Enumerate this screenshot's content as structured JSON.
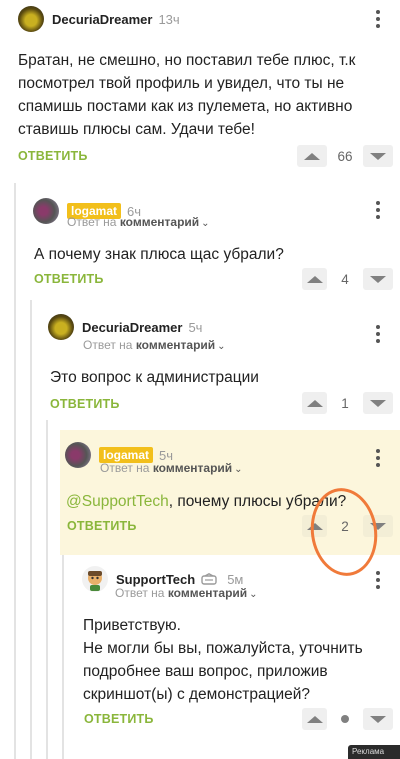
{
  "colors": {
    "accent": "#8ab63b",
    "tag": "#f2bf1b",
    "highlight": "#fcf6dc",
    "annotation": "#f07a3a"
  },
  "reply_prefix": "Ответ на",
  "reply_target": "комментарий",
  "reply_label": "ОТВЕТИТЬ",
  "comments": [
    {
      "author": "DecuriaDreamer",
      "time": "13ч",
      "text": "Братан, не смешно, но поставил тебе плюс, т.к посмотрел твой профиль и увидел, что ты не спамишь постами как из пулемета, но активно ставишь плюсы сам. Удачи тебе!",
      "votes": "66"
    },
    {
      "author": "logamat",
      "time": "6ч",
      "text": "А почему знак плюса щас убрали?",
      "votes": "4"
    },
    {
      "author": "DecuriaDreamer",
      "time": "5ч",
      "text": "Это вопрос к администрации",
      "votes": "1"
    },
    {
      "author": "logamat",
      "time": "5ч",
      "mention": "@SupportTech",
      "text": ", почему плюсы убрали?",
      "votes": "2"
    },
    {
      "author": "SupportTech",
      "author_icon": "moderator-badge-icon",
      "time": "5м",
      "text_lines": [
        "Приветствую.",
        "Не могли бы вы, пожалуйста, уточнить подробнее ваш вопрос, приложив скриншот(ы) с демонстрацией?"
      ],
      "votes": ""
    }
  ],
  "ad_badge": "Реклама"
}
